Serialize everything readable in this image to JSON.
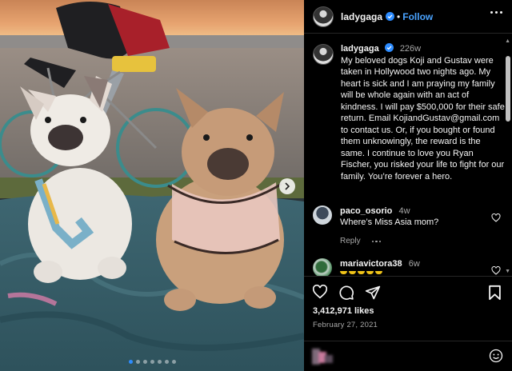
{
  "post": {
    "author": "ladygaga",
    "follow_label": "Follow",
    "separator": "•",
    "caption_time": "226w",
    "caption": "My beloved dogs Koji and Gustav were taken in Hollywood two nights ago. My heart is sick and I am praying my family will be whole again with an act of kindness. I will pay $500,000 for their safe return. Email KojiandGustav@gmail.com to contact us. Or, if you bought or found them unknowingly, the reward is the same. I continue to love you Ryan Fischer, you risked your life to fight for our family. You’re forever a hero.",
    "likes": "3,412,971 likes",
    "date": "February 27, 2021"
  },
  "comments": [
    {
      "user": "paco_osorio",
      "time": "4w",
      "text": "Where’s Miss Asia mom?",
      "reply_label": "Reply"
    },
    {
      "user": "mariavictora38",
      "time": "6w",
      "text": ""
    }
  ],
  "carousel": {
    "dots": 7,
    "active": 0
  },
  "icons": {
    "like": "heart-icon",
    "comment": "comment-icon",
    "share": "share-icon",
    "save": "bookmark-icon",
    "emoji": "emoji-icon",
    "next": "chevron-right-icon",
    "verified": "verified-badge-icon",
    "more": "more-options-icon"
  },
  "colors": {
    "accent": "#4aa3ff",
    "verified": "#2d8cff",
    "background": "#000000",
    "muted": "#a8a8a8"
  }
}
